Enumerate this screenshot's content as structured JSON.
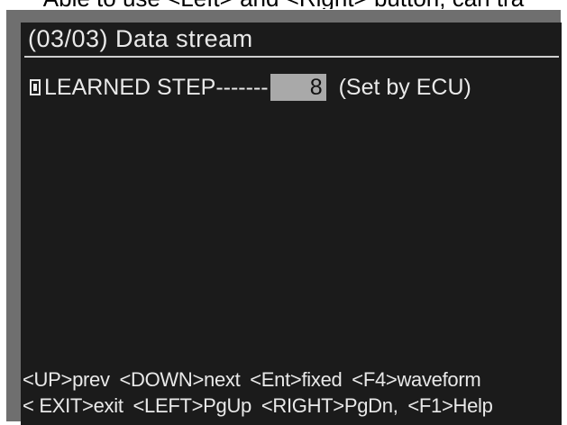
{
  "caption": "Able to use <Left> and <Right> button, can tra",
  "screen": {
    "title": "(03/03)  Data stream",
    "row": {
      "label": "LEARNED STEP-------",
      "value": "8",
      "note": "(Set by ECU)"
    },
    "footer": {
      "line1": [
        {
          "key": "<UP>",
          "action": "prev"
        },
        {
          "key": "<DOWN>",
          "action": "next"
        },
        {
          "key": "<Ent>",
          "action": "fixed"
        },
        {
          "key": "<F4>",
          "action": "waveform"
        }
      ],
      "line2": [
        {
          "key": "< EXIT>",
          "action": "exit"
        },
        {
          "key": "<LEFT>",
          "action": "PgUp"
        },
        {
          "key": "<RIGHT>",
          "action": "PgDn,"
        },
        {
          "key": "<F1>",
          "action": "Help"
        }
      ]
    }
  },
  "colors": {
    "screen_bg": "#1b1b1b",
    "text": "#e9e9e9",
    "frame": "#6f6f6f",
    "value_highlight": "#a9a9a9"
  }
}
